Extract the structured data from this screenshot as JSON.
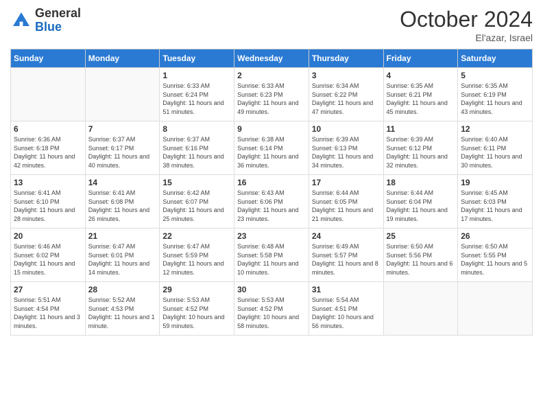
{
  "logo": {
    "general": "General",
    "blue": "Blue"
  },
  "header": {
    "month": "October 2024",
    "location": "El'azar, Israel"
  },
  "weekdays": [
    "Sunday",
    "Monday",
    "Tuesday",
    "Wednesday",
    "Thursday",
    "Friday",
    "Saturday"
  ],
  "days": [
    {
      "num": "",
      "info": ""
    },
    {
      "num": "",
      "info": ""
    },
    {
      "num": "1",
      "sunrise": "6:33 AM",
      "sunset": "6:24 PM",
      "daylight": "11 hours and 51 minutes."
    },
    {
      "num": "2",
      "sunrise": "6:33 AM",
      "sunset": "6:23 PM",
      "daylight": "11 hours and 49 minutes."
    },
    {
      "num": "3",
      "sunrise": "6:34 AM",
      "sunset": "6:22 PM",
      "daylight": "11 hours and 47 minutes."
    },
    {
      "num": "4",
      "sunrise": "6:35 AM",
      "sunset": "6:21 PM",
      "daylight": "11 hours and 45 minutes."
    },
    {
      "num": "5",
      "sunrise": "6:35 AM",
      "sunset": "6:19 PM",
      "daylight": "11 hours and 43 minutes."
    },
    {
      "num": "6",
      "sunrise": "6:36 AM",
      "sunset": "6:18 PM",
      "daylight": "11 hours and 42 minutes."
    },
    {
      "num": "7",
      "sunrise": "6:37 AM",
      "sunset": "6:17 PM",
      "daylight": "11 hours and 40 minutes."
    },
    {
      "num": "8",
      "sunrise": "6:37 AM",
      "sunset": "6:16 PM",
      "daylight": "11 hours and 38 minutes."
    },
    {
      "num": "9",
      "sunrise": "6:38 AM",
      "sunset": "6:14 PM",
      "daylight": "11 hours and 36 minutes."
    },
    {
      "num": "10",
      "sunrise": "6:39 AM",
      "sunset": "6:13 PM",
      "daylight": "11 hours and 34 minutes."
    },
    {
      "num": "11",
      "sunrise": "6:39 AM",
      "sunset": "6:12 PM",
      "daylight": "11 hours and 32 minutes."
    },
    {
      "num": "12",
      "sunrise": "6:40 AM",
      "sunset": "6:11 PM",
      "daylight": "11 hours and 30 minutes."
    },
    {
      "num": "13",
      "sunrise": "6:41 AM",
      "sunset": "6:10 PM",
      "daylight": "11 hours and 28 minutes."
    },
    {
      "num": "14",
      "sunrise": "6:41 AM",
      "sunset": "6:08 PM",
      "daylight": "11 hours and 26 minutes."
    },
    {
      "num": "15",
      "sunrise": "6:42 AM",
      "sunset": "6:07 PM",
      "daylight": "11 hours and 25 minutes."
    },
    {
      "num": "16",
      "sunrise": "6:43 AM",
      "sunset": "6:06 PM",
      "daylight": "11 hours and 23 minutes."
    },
    {
      "num": "17",
      "sunrise": "6:44 AM",
      "sunset": "6:05 PM",
      "daylight": "11 hours and 21 minutes."
    },
    {
      "num": "18",
      "sunrise": "6:44 AM",
      "sunset": "6:04 PM",
      "daylight": "11 hours and 19 minutes."
    },
    {
      "num": "19",
      "sunrise": "6:45 AM",
      "sunset": "6:03 PM",
      "daylight": "11 hours and 17 minutes."
    },
    {
      "num": "20",
      "sunrise": "6:46 AM",
      "sunset": "6:02 PM",
      "daylight": "11 hours and 15 minutes."
    },
    {
      "num": "21",
      "sunrise": "6:47 AM",
      "sunset": "6:01 PM",
      "daylight": "11 hours and 14 minutes."
    },
    {
      "num": "22",
      "sunrise": "6:47 AM",
      "sunset": "5:59 PM",
      "daylight": "11 hours and 12 minutes."
    },
    {
      "num": "23",
      "sunrise": "6:48 AM",
      "sunset": "5:58 PM",
      "daylight": "11 hours and 10 minutes."
    },
    {
      "num": "24",
      "sunrise": "6:49 AM",
      "sunset": "5:57 PM",
      "daylight": "11 hours and 8 minutes."
    },
    {
      "num": "25",
      "sunrise": "6:50 AM",
      "sunset": "5:56 PM",
      "daylight": "11 hours and 6 minutes."
    },
    {
      "num": "26",
      "sunrise": "6:50 AM",
      "sunset": "5:55 PM",
      "daylight": "11 hours and 5 minutes."
    },
    {
      "num": "27",
      "sunrise": "5:51 AM",
      "sunset": "4:54 PM",
      "daylight": "11 hours and 3 minutes."
    },
    {
      "num": "28",
      "sunrise": "5:52 AM",
      "sunset": "4:53 PM",
      "daylight": "11 hours and 1 minute."
    },
    {
      "num": "29",
      "sunrise": "5:53 AM",
      "sunset": "4:52 PM",
      "daylight": "10 hours and 59 minutes."
    },
    {
      "num": "30",
      "sunrise": "5:53 AM",
      "sunset": "4:52 PM",
      "daylight": "10 hours and 58 minutes."
    },
    {
      "num": "31",
      "sunrise": "5:54 AM",
      "sunset": "4:51 PM",
      "daylight": "10 hours and 56 minutes."
    },
    {
      "num": "",
      "info": ""
    },
    {
      "num": "",
      "info": ""
    }
  ]
}
